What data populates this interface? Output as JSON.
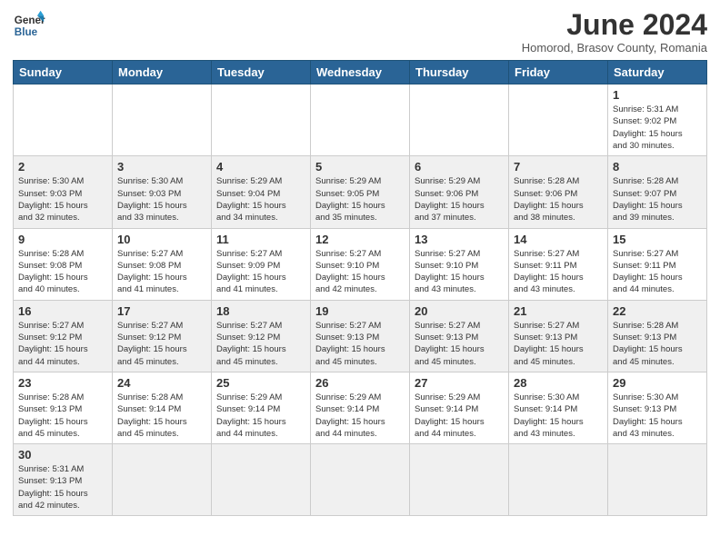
{
  "header": {
    "logo_line1": "General",
    "logo_line2": "Blue",
    "month_title": "June 2024",
    "subtitle": "Homorod, Brasov County, Romania"
  },
  "weekdays": [
    "Sunday",
    "Monday",
    "Tuesday",
    "Wednesday",
    "Thursday",
    "Friday",
    "Saturday"
  ],
  "weeks": [
    [
      {
        "day": "",
        "info": ""
      },
      {
        "day": "",
        "info": ""
      },
      {
        "day": "",
        "info": ""
      },
      {
        "day": "",
        "info": ""
      },
      {
        "day": "",
        "info": ""
      },
      {
        "day": "",
        "info": ""
      },
      {
        "day": "1",
        "info": "Sunrise: 5:31 AM\nSunset: 9:02 PM\nDaylight: 15 hours\nand 30 minutes."
      }
    ],
    [
      {
        "day": "2",
        "info": "Sunrise: 5:30 AM\nSunset: 9:03 PM\nDaylight: 15 hours\nand 32 minutes."
      },
      {
        "day": "3",
        "info": "Sunrise: 5:30 AM\nSunset: 9:03 PM\nDaylight: 15 hours\nand 33 minutes."
      },
      {
        "day": "4",
        "info": "Sunrise: 5:29 AM\nSunset: 9:04 PM\nDaylight: 15 hours\nand 34 minutes."
      },
      {
        "day": "5",
        "info": "Sunrise: 5:29 AM\nSunset: 9:05 PM\nDaylight: 15 hours\nand 35 minutes."
      },
      {
        "day": "6",
        "info": "Sunrise: 5:29 AM\nSunset: 9:06 PM\nDaylight: 15 hours\nand 37 minutes."
      },
      {
        "day": "7",
        "info": "Sunrise: 5:28 AM\nSunset: 9:06 PM\nDaylight: 15 hours\nand 38 minutes."
      },
      {
        "day": "8",
        "info": "Sunrise: 5:28 AM\nSunset: 9:07 PM\nDaylight: 15 hours\nand 39 minutes."
      }
    ],
    [
      {
        "day": "9",
        "info": "Sunrise: 5:28 AM\nSunset: 9:08 PM\nDaylight: 15 hours\nand 40 minutes."
      },
      {
        "day": "10",
        "info": "Sunrise: 5:27 AM\nSunset: 9:08 PM\nDaylight: 15 hours\nand 41 minutes."
      },
      {
        "day": "11",
        "info": "Sunrise: 5:27 AM\nSunset: 9:09 PM\nDaylight: 15 hours\nand 41 minutes."
      },
      {
        "day": "12",
        "info": "Sunrise: 5:27 AM\nSunset: 9:10 PM\nDaylight: 15 hours\nand 42 minutes."
      },
      {
        "day": "13",
        "info": "Sunrise: 5:27 AM\nSunset: 9:10 PM\nDaylight: 15 hours\nand 43 minutes."
      },
      {
        "day": "14",
        "info": "Sunrise: 5:27 AM\nSunset: 9:11 PM\nDaylight: 15 hours\nand 43 minutes."
      },
      {
        "day": "15",
        "info": "Sunrise: 5:27 AM\nSunset: 9:11 PM\nDaylight: 15 hours\nand 44 minutes."
      }
    ],
    [
      {
        "day": "16",
        "info": "Sunrise: 5:27 AM\nSunset: 9:12 PM\nDaylight: 15 hours\nand 44 minutes."
      },
      {
        "day": "17",
        "info": "Sunrise: 5:27 AM\nSunset: 9:12 PM\nDaylight: 15 hours\nand 45 minutes."
      },
      {
        "day": "18",
        "info": "Sunrise: 5:27 AM\nSunset: 9:12 PM\nDaylight: 15 hours\nand 45 minutes."
      },
      {
        "day": "19",
        "info": "Sunrise: 5:27 AM\nSunset: 9:13 PM\nDaylight: 15 hours\nand 45 minutes."
      },
      {
        "day": "20",
        "info": "Sunrise: 5:27 AM\nSunset: 9:13 PM\nDaylight: 15 hours\nand 45 minutes."
      },
      {
        "day": "21",
        "info": "Sunrise: 5:27 AM\nSunset: 9:13 PM\nDaylight: 15 hours\nand 45 minutes."
      },
      {
        "day": "22",
        "info": "Sunrise: 5:28 AM\nSunset: 9:13 PM\nDaylight: 15 hours\nand 45 minutes."
      }
    ],
    [
      {
        "day": "23",
        "info": "Sunrise: 5:28 AM\nSunset: 9:13 PM\nDaylight: 15 hours\nand 45 minutes."
      },
      {
        "day": "24",
        "info": "Sunrise: 5:28 AM\nSunset: 9:14 PM\nDaylight: 15 hours\nand 45 minutes."
      },
      {
        "day": "25",
        "info": "Sunrise: 5:29 AM\nSunset: 9:14 PM\nDaylight: 15 hours\nand 44 minutes."
      },
      {
        "day": "26",
        "info": "Sunrise: 5:29 AM\nSunset: 9:14 PM\nDaylight: 15 hours\nand 44 minutes."
      },
      {
        "day": "27",
        "info": "Sunrise: 5:29 AM\nSunset: 9:14 PM\nDaylight: 15 hours\nand 44 minutes."
      },
      {
        "day": "28",
        "info": "Sunrise: 5:30 AM\nSunset: 9:14 PM\nDaylight: 15 hours\nand 43 minutes."
      },
      {
        "day": "29",
        "info": "Sunrise: 5:30 AM\nSunset: 9:13 PM\nDaylight: 15 hours\nand 43 minutes."
      }
    ],
    [
      {
        "day": "30",
        "info": "Sunrise: 5:31 AM\nSunset: 9:13 PM\nDaylight: 15 hours\nand 42 minutes."
      },
      {
        "day": "",
        "info": ""
      },
      {
        "day": "",
        "info": ""
      },
      {
        "day": "",
        "info": ""
      },
      {
        "day": "",
        "info": ""
      },
      {
        "day": "",
        "info": ""
      },
      {
        "day": "",
        "info": ""
      }
    ]
  ]
}
